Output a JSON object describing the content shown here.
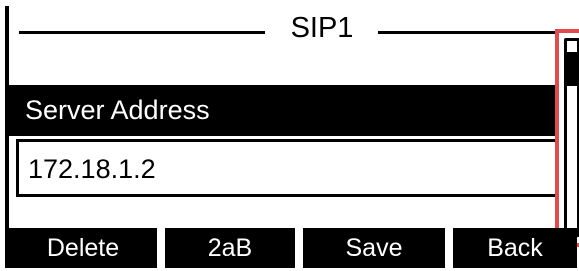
{
  "screen": {
    "title": "SIP1"
  },
  "field": {
    "label": "Server Address",
    "value": "172.18.1.2"
  },
  "scrollbar": {
    "highlight_color": "#e24b4b"
  },
  "softkeys": [
    {
      "label": "Delete"
    },
    {
      "label": "2aB"
    },
    {
      "label": "Save"
    },
    {
      "label": "Back"
    }
  ]
}
